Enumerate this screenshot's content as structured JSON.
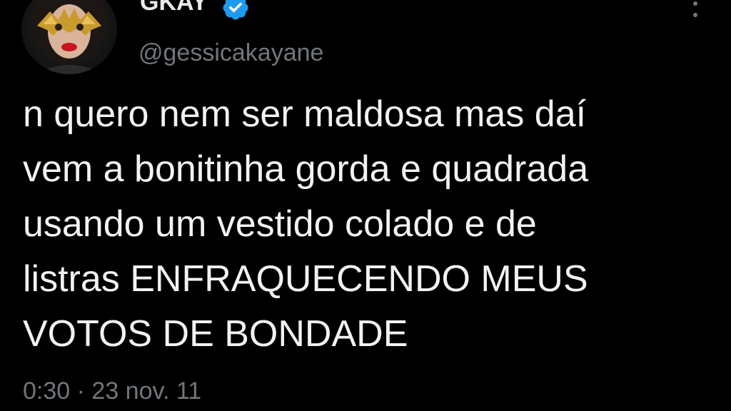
{
  "tweet": {
    "author_name": "GKAY",
    "author_handle": "@gessicakayane",
    "verified": true,
    "text": "n quero nem ser maldosa mas daí\nvem a bonitinha gorda e quadrada\nusando um vestido colado e de\nlistras ENFRAQUECENDO MEUS\nVOTOS DE BONDADE",
    "time": "0:30",
    "separator": "·",
    "date": "23 nov. 11"
  },
  "icons": {
    "verified": "verified-badge-icon",
    "more": "more-options-icon"
  },
  "colors": {
    "background": "#000000",
    "text": "#e7e9ea",
    "muted": "#71767b",
    "verified": "#1d9bf0"
  }
}
